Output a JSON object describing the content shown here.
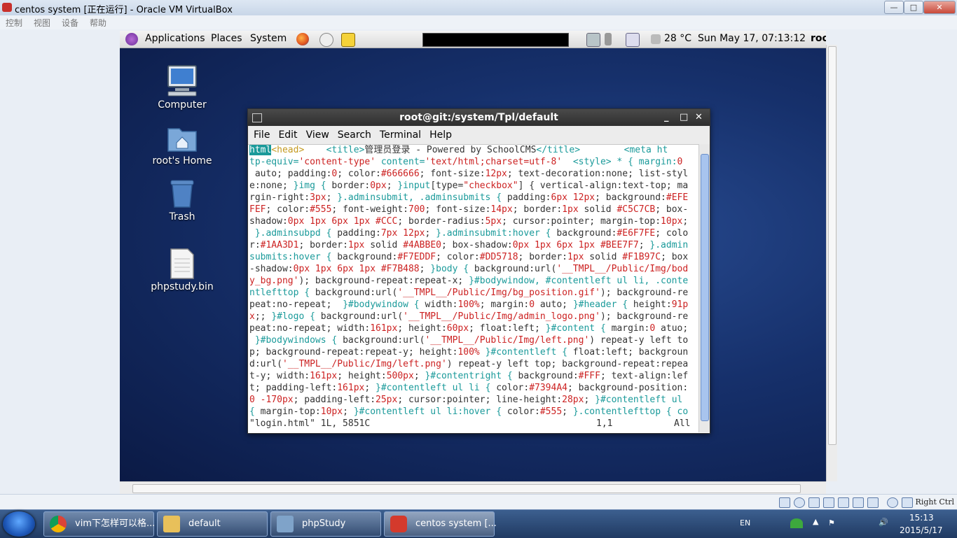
{
  "vbox": {
    "window_title": "centos system [正在运行] - Oracle VM VirtualBox",
    "menu": [
      "控制",
      "视图",
      "设备",
      "帮助"
    ],
    "right_ctrl": "Right Ctrl",
    "buttons": {
      "minimize": "—",
      "maximize": "□",
      "close": "✕"
    }
  },
  "gnome": {
    "menus": [
      "Applications",
      "Places",
      "System"
    ],
    "temperature": "28 °C",
    "datetime": "Sun May 17, 07:13:12",
    "user": "roo"
  },
  "desktop": {
    "icons": [
      {
        "label": "Computer"
      },
      {
        "label": "root's Home"
      },
      {
        "label": "Trash"
      },
      {
        "label": "phpstudy.bin"
      }
    ]
  },
  "terminal": {
    "title": "root@git:/system/Tpl/default",
    "menu": [
      "File",
      "Edit",
      "View",
      "Search",
      "Terminal",
      "Help"
    ],
    "lines": [
      [
        [
          "t",
          "html"
        ],
        [
          "g",
          "<head>    "
        ],
        [
          "a",
          "<title>"
        ],
        [
          "d",
          "管理员登录 - Powered by SchoolCMS"
        ],
        [
          "a",
          "</title>"
        ],
        [
          "d",
          "        "
        ],
        [
          "a",
          "<meta ht"
        ]
      ],
      [
        [
          "a",
          "tp-equiv="
        ],
        [
          "s",
          "'content-type'"
        ],
        [
          "a",
          " content="
        ],
        [
          "s",
          "'text/html;charset=utf-8'"
        ],
        [
          "d",
          "  "
        ],
        [
          "a",
          "<style>"
        ],
        [
          "a",
          " * { margin:"
        ],
        [
          "s",
          "0"
        ]
      ],
      [
        [
          "d",
          " auto; padding:"
        ],
        [
          "s",
          "0"
        ],
        [
          "d",
          "; color:"
        ],
        [
          "s",
          "#666666"
        ],
        [
          "d",
          "; font-size:"
        ],
        [
          "s",
          "12px"
        ],
        [
          "d",
          "; text-decoration:none; list-styl"
        ]
      ],
      [
        [
          "d",
          "e:none; "
        ],
        [
          "a",
          "}img { "
        ],
        [
          "d",
          "border:"
        ],
        [
          "s",
          "0px"
        ],
        [
          "d",
          "; "
        ],
        [
          "a",
          "}input"
        ],
        [
          "d",
          "[type="
        ],
        [
          "s",
          "\"checkbox\""
        ],
        [
          "d",
          "] { vertical-align:text-top; ma"
        ]
      ],
      [
        [
          "d",
          "rgin-right:"
        ],
        [
          "s",
          "3px"
        ],
        [
          "d",
          "; "
        ],
        [
          "a",
          "}.adminsubmit, .adminsubmits { "
        ],
        [
          "d",
          "padding:"
        ],
        [
          "s",
          "6px 12px"
        ],
        [
          "d",
          "; background:"
        ],
        [
          "s",
          "#EFE"
        ]
      ],
      [
        [
          "s",
          "FEF"
        ],
        [
          "d",
          "; color:"
        ],
        [
          "s",
          "#555"
        ],
        [
          "d",
          "; font-weight:"
        ],
        [
          "s",
          "700"
        ],
        [
          "d",
          "; font-size:"
        ],
        [
          "s",
          "14px"
        ],
        [
          "d",
          "; border:"
        ],
        [
          "s",
          "1px"
        ],
        [
          "d",
          " solid "
        ],
        [
          "s",
          "#C5C7CB"
        ],
        [
          "d",
          "; box-"
        ]
      ],
      [
        [
          "d",
          "shadow:"
        ],
        [
          "s",
          "0px 1px 6px 1px #CCC"
        ],
        [
          "d",
          "; border-radius:"
        ],
        [
          "s",
          "5px"
        ],
        [
          "d",
          "; cursor:pointer; margin-top:"
        ],
        [
          "s",
          "10px"
        ],
        [
          "d",
          ";"
        ]
      ],
      [
        [
          "a",
          " }.adminsubpd { "
        ],
        [
          "d",
          "padding:"
        ],
        [
          "s",
          "7px 12px"
        ],
        [
          "d",
          "; "
        ],
        [
          "a",
          "}.adminsubmit:hover { "
        ],
        [
          "d",
          "background:"
        ],
        [
          "s",
          "#E6F7FE"
        ],
        [
          "d",
          "; colo"
        ]
      ],
      [
        [
          "d",
          "r:"
        ],
        [
          "s",
          "#1AA3D1"
        ],
        [
          "d",
          "; border:"
        ],
        [
          "s",
          "1px"
        ],
        [
          "d",
          " solid "
        ],
        [
          "s",
          "#4ABBE0"
        ],
        [
          "d",
          "; box-shadow:"
        ],
        [
          "s",
          "0px 1px 6px 1px #BEE7F7"
        ],
        [
          "d",
          "; "
        ],
        [
          "a",
          "}.admin"
        ]
      ],
      [
        [
          "a",
          "submits:hover { "
        ],
        [
          "d",
          "background:"
        ],
        [
          "s",
          "#F7EDDF"
        ],
        [
          "d",
          "; color:"
        ],
        [
          "s",
          "#DD5718"
        ],
        [
          "d",
          "; border:"
        ],
        [
          "s",
          "1px"
        ],
        [
          "d",
          " solid "
        ],
        [
          "s",
          "#F1B97C"
        ],
        [
          "d",
          "; box"
        ]
      ],
      [
        [
          "d",
          "-shadow:"
        ],
        [
          "s",
          "0px 1px 6px 1px #F7B488"
        ],
        [
          "d",
          "; "
        ],
        [
          "a",
          "}body { "
        ],
        [
          "d",
          "background:url("
        ],
        [
          "s",
          "'__TMPL__/Public/Img/bod"
        ]
      ],
      [
        [
          "s",
          "y_bg.png'"
        ],
        [
          "d",
          "); background-repeat:repeat-x; "
        ],
        [
          "a",
          "}#bodywindow, #contentleft ul li, .conte"
        ]
      ],
      [
        [
          "a",
          "ntlefttop { "
        ],
        [
          "d",
          "background:url("
        ],
        [
          "s",
          "'__TMPL__/Public/Img/bg_position.gif'"
        ],
        [
          "d",
          "); background-re"
        ]
      ],
      [
        [
          "d",
          "peat:no-repeat;  "
        ],
        [
          "a",
          "}#bodywindow { "
        ],
        [
          "d",
          "width:"
        ],
        [
          "s",
          "100%"
        ],
        [
          "d",
          "; margin:"
        ],
        [
          "s",
          "0"
        ],
        [
          "d",
          " auto; "
        ],
        [
          "a",
          "}#header { "
        ],
        [
          "d",
          "height:"
        ],
        [
          "s",
          "91p"
        ]
      ],
      [
        [
          "s",
          "x"
        ],
        [
          "d",
          ";; "
        ],
        [
          "a",
          "}#logo { "
        ],
        [
          "d",
          "background:url("
        ],
        [
          "s",
          "'__TMPL__/Public/Img/admin_logo.png'"
        ],
        [
          "d",
          "); background-re"
        ]
      ],
      [
        [
          "d",
          "peat:no-repeat; width:"
        ],
        [
          "s",
          "161px"
        ],
        [
          "d",
          "; height:"
        ],
        [
          "s",
          "60px"
        ],
        [
          "d",
          "; float:left; "
        ],
        [
          "a",
          "}#content { "
        ],
        [
          "d",
          "margin:"
        ],
        [
          "s",
          "0"
        ],
        [
          "d",
          " atuo;"
        ]
      ],
      [
        [
          "a",
          " }#bodywindows { "
        ],
        [
          "d",
          "background:url("
        ],
        [
          "s",
          "'__TMPL__/Public/Img/left.png'"
        ],
        [
          "d",
          ") repeat-y left to"
        ]
      ],
      [
        [
          "d",
          "p; background-repeat:repeat-y; height:"
        ],
        [
          "s",
          "100%"
        ],
        [
          "d",
          " "
        ],
        [
          "a",
          "}#contentleft { "
        ],
        [
          "d",
          "float:left; backgroun"
        ]
      ],
      [
        [
          "d",
          "d:url("
        ],
        [
          "s",
          "'__TMPL__/Public/Img/left.png'"
        ],
        [
          "d",
          ") repeat-y left top; background-repeat:repea"
        ]
      ],
      [
        [
          "d",
          "t-y; width:"
        ],
        [
          "s",
          "161px"
        ],
        [
          "d",
          "; height:"
        ],
        [
          "s",
          "500px"
        ],
        [
          "d",
          "; "
        ],
        [
          "a",
          "}#contentright { "
        ],
        [
          "d",
          "background:"
        ],
        [
          "s",
          "#FFF"
        ],
        [
          "d",
          "; text-align:lef"
        ]
      ],
      [
        [
          "d",
          "t; padding-left:"
        ],
        [
          "s",
          "161px"
        ],
        [
          "d",
          "; "
        ],
        [
          "a",
          "}#contentleft ul li { "
        ],
        [
          "d",
          "color:"
        ],
        [
          "s",
          "#7394A4"
        ],
        [
          "d",
          "; background-position:"
        ]
      ],
      [
        [
          "s",
          "0 -170px"
        ],
        [
          "d",
          "; padding-left:"
        ],
        [
          "s",
          "25px"
        ],
        [
          "d",
          "; cursor:pointer; line-height:"
        ],
        [
          "s",
          "28px"
        ],
        [
          "d",
          "; "
        ],
        [
          "a",
          "}#contentleft ul"
        ]
      ],
      [
        [
          "a",
          "{ "
        ],
        [
          "d",
          "margin-top:"
        ],
        [
          "s",
          "10px"
        ],
        [
          "d",
          "; "
        ],
        [
          "a",
          "}#contentleft ul li:hover { "
        ],
        [
          "d",
          "color:"
        ],
        [
          "s",
          "#555"
        ],
        [
          "d",
          "; "
        ],
        [
          "a",
          "}.contentlefttop { co"
        ]
      ]
    ],
    "status_left": "\"login.html\" 1L, 5851C",
    "status_pos": "1,1",
    "status_right": "All"
  },
  "taskbar": {
    "tasks": [
      "vim下怎样可以格...",
      "default",
      "phpStudy",
      "centos system [..."
    ],
    "lang": "EN",
    "time": "15:13",
    "date": "2015/5/17"
  }
}
